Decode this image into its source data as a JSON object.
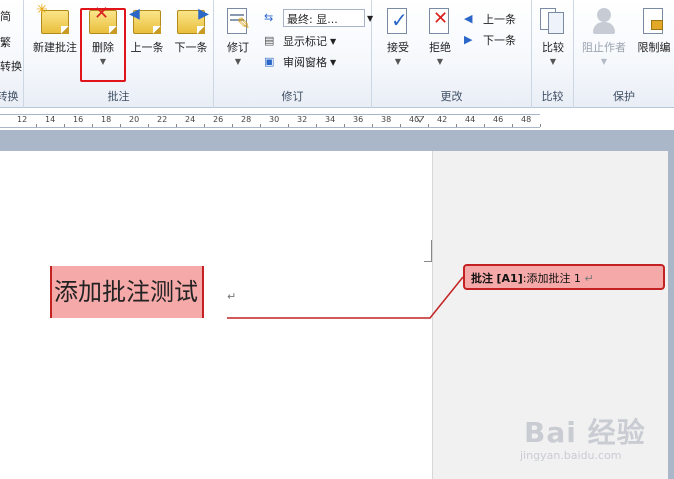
{
  "ribbon": {
    "left_partial": [
      "简",
      "繁",
      "转换"
    ],
    "groups": {
      "convert": {
        "label": "转换"
      },
      "comments": {
        "label": "批注",
        "new_comment": "新建批注",
        "delete": "删除",
        "previous": "上一条",
        "next": "下一条"
      },
      "tracking": {
        "label": "修订",
        "track_changes": "修订",
        "display_select": "最终: 显...",
        "show_markup": "显示标记",
        "reviewing_pane": "审阅窗格"
      },
      "changes": {
        "label": "更改",
        "accept": "接受",
        "reject": "拒绝",
        "previous": "上一条",
        "next": "下一条"
      },
      "compare": {
        "label": "比较",
        "compare": "比较"
      },
      "protect": {
        "label": "保护",
        "block_authors": "阻止作者",
        "restrict_editing": "限制编"
      }
    }
  },
  "ruler": {
    "ticks": [
      "12",
      "14",
      "16",
      "18",
      "20",
      "22",
      "24",
      "26",
      "28",
      "30",
      "32",
      "34",
      "36",
      "38",
      "40",
      "42",
      "44",
      "46",
      "48"
    ]
  },
  "document": {
    "commented_text": "添加批注测试",
    "paragraph_mark": "↵"
  },
  "comment": {
    "label": "批注",
    "ref": "[A1]",
    "text": ":添加批注 1",
    "mark": "↵"
  },
  "watermark": {
    "text": "Bai 经验",
    "sub": "jingyan.baidu.com"
  },
  "colors": {
    "highlight": "#e0141a",
    "comment_fill": "#f5a9a9",
    "comment_border": "#c42222"
  }
}
